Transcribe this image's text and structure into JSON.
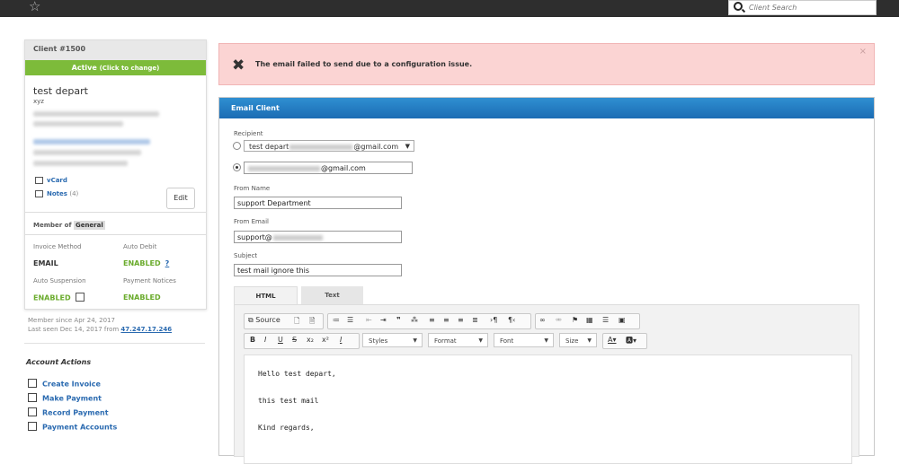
{
  "topbar": {
    "star_icon": "star-icon",
    "search_placeholder": "Client Search"
  },
  "client": {
    "header": "Client #1500",
    "status_label": "Active",
    "status_hint": "(Click to change)",
    "name": "test depart",
    "company": "xyz",
    "vcard_label": "vCard",
    "notes_label": "Notes",
    "notes_count": "(4)",
    "edit_label": "Edit",
    "member_of_label": "Member of",
    "group": "General",
    "invoice_method_label": "Invoice Method",
    "invoice_method": "EMAIL",
    "auto_debit_label": "Auto Debit",
    "auto_debit": "ENABLED",
    "auto_debit_help": "?",
    "auto_suspension_label": "Auto Suspension",
    "auto_suspension": "ENABLED",
    "payment_notices_label": "Payment Notices",
    "payment_notices": "ENABLED",
    "member_since": "Member since Apr 24, 2017",
    "last_seen": "Last seen Dec 14, 2017 from",
    "last_ip": "47.247.17.246"
  },
  "account_actions": {
    "title": "Account Actions",
    "items": [
      {
        "label": "Create Invoice",
        "icon": "document-icon"
      },
      {
        "label": "Make Payment",
        "icon": "credit-card-icon"
      },
      {
        "label": "Record Payment",
        "icon": "cash-icon"
      },
      {
        "label": "Payment Accounts",
        "icon": "bank-icon"
      }
    ]
  },
  "alert": {
    "message": "The email failed to send due to a configuration issue.",
    "close": "×"
  },
  "email_client": {
    "title": "Email Client",
    "recipient_label": "Recipient",
    "recipient_option1_prefix": "test depart",
    "recipient_option1_suffix": "@gmail.com",
    "recipient_option2_suffix": "@gmail.com",
    "from_name_label": "From Name",
    "from_name": "support Department",
    "from_email_label": "From Email",
    "from_email_prefix": "support@",
    "subject_label": "Subject",
    "subject": "test mail ignore this",
    "tabs": [
      "HTML",
      "Text"
    ],
    "toolbar": {
      "source": "Source",
      "styles": "Styles",
      "format": "Format",
      "font": "Font",
      "size": "Size"
    },
    "body_lines": [
      "Hello test depart,",
      "this test mail",
      "Kind regards,"
    ]
  }
}
